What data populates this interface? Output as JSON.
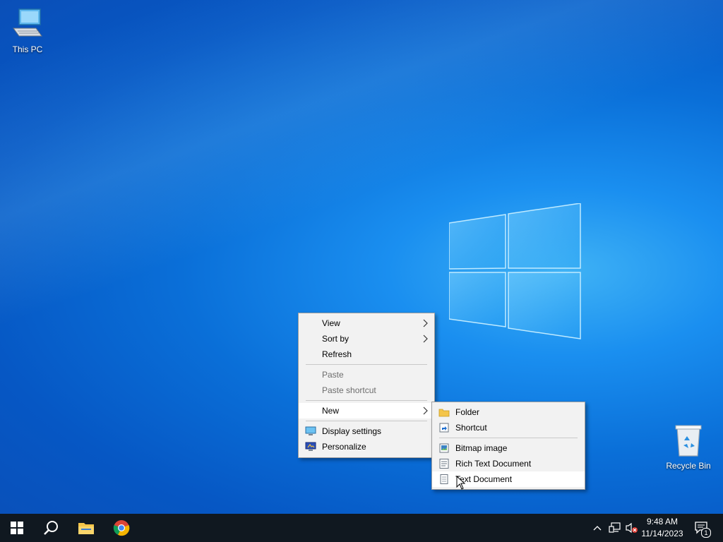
{
  "desktop": {
    "icons": [
      {
        "label": "This PC",
        "icon": "this-pc-icon"
      },
      {
        "label": "Recycle Bin",
        "icon": "recycle-bin-icon"
      }
    ]
  },
  "context_menu": {
    "items": [
      {
        "label": "View",
        "has_submenu": true
      },
      {
        "label": "Sort by",
        "has_submenu": true
      },
      {
        "label": "Refresh"
      },
      {
        "label": "Paste",
        "disabled": true
      },
      {
        "label": "Paste shortcut",
        "disabled": true
      },
      {
        "label": "New",
        "has_submenu": true,
        "highlighted": true
      },
      {
        "label": "Display settings",
        "icon": "display-settings-icon"
      },
      {
        "label": "Personalize",
        "icon": "personalize-icon"
      }
    ]
  },
  "new_submenu": {
    "items": [
      {
        "label": "Folder",
        "icon": "folder-icon"
      },
      {
        "label": "Shortcut",
        "icon": "shortcut-icon"
      },
      {
        "label": "Bitmap image",
        "icon": "bitmap-icon"
      },
      {
        "label": "Rich Text Document",
        "icon": "rich-text-icon"
      },
      {
        "label": "Text Document",
        "icon": "text-document-icon",
        "highlighted": true
      }
    ]
  },
  "taskbar": {
    "pinned": [
      "start-icon",
      "search-icon",
      "file-explorer-icon",
      "chrome-icon"
    ],
    "tray": {
      "time": "9:48 AM",
      "date": "11/14/2023",
      "notification_count": "1"
    }
  },
  "colors": {
    "desktop_accent": "#0a6fd8",
    "menu_bg": "#f2f2f2",
    "taskbar_bg": "#101820"
  }
}
